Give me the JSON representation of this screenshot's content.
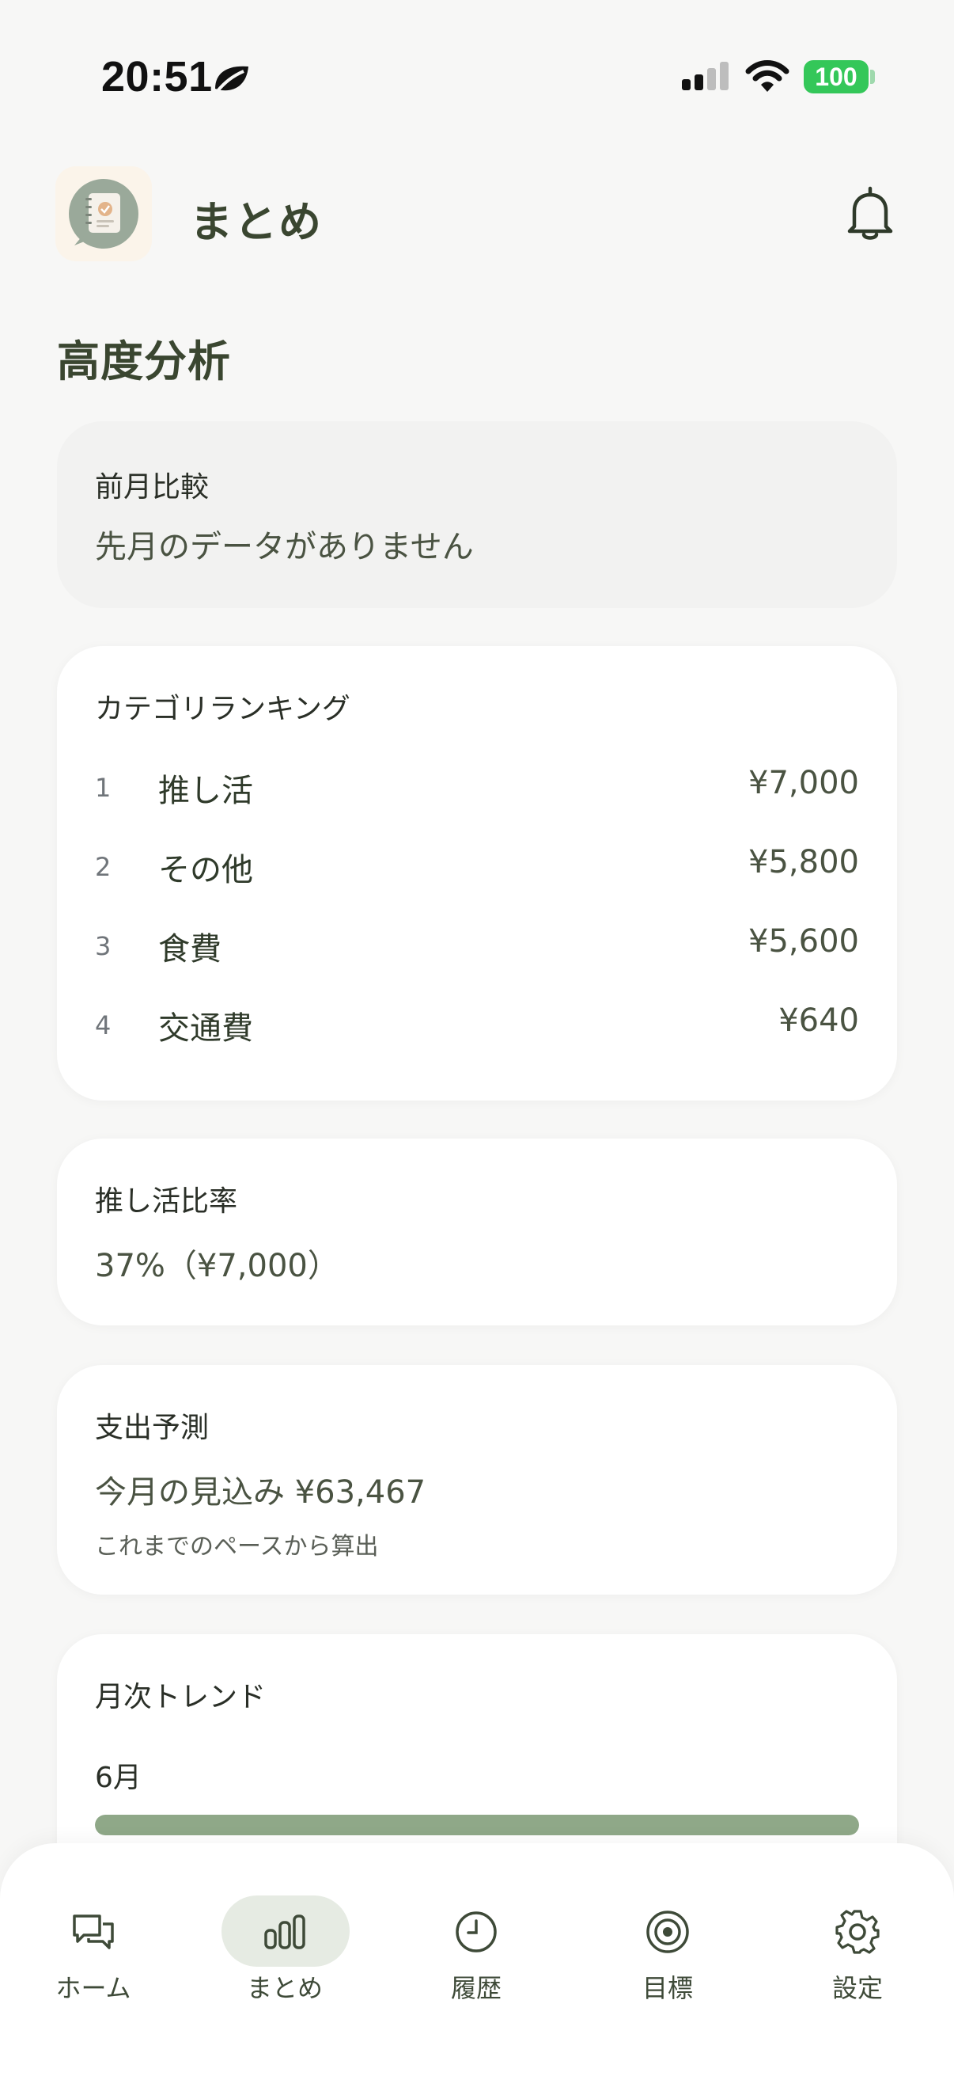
{
  "status_bar": {
    "time": "20:51",
    "battery": "100"
  },
  "header": {
    "title": "まとめ"
  },
  "section_title": "高度分析",
  "month_compare": {
    "title": "前月比較",
    "message": "先月のデータがありません"
  },
  "category_ranking": {
    "title": "カテゴリランキング",
    "items": [
      {
        "rank": "1",
        "name": "推し活",
        "amount": "¥7,000"
      },
      {
        "rank": "2",
        "name": "その他",
        "amount": "¥5,800"
      },
      {
        "rank": "3",
        "name": "食費",
        "amount": "¥5,600"
      },
      {
        "rank": "4",
        "name": "交通費",
        "amount": "¥640"
      }
    ]
  },
  "oshi_ratio": {
    "title": "推し活比率",
    "value": "37%（¥7,000）"
  },
  "forecast": {
    "title": "支出予測",
    "value": "今月の見込み ¥63,467",
    "note": "これまでのペースから算出"
  },
  "monthly_trend": {
    "title": "月次トレンド",
    "month": "6月",
    "fill_fraction": 1.0
  },
  "nav": {
    "items": [
      {
        "label": "ホーム",
        "icon": "chat-icon"
      },
      {
        "label": "まとめ",
        "icon": "bar-chart-icon",
        "active": true
      },
      {
        "label": "履歴",
        "icon": "clock-icon"
      },
      {
        "label": "目標",
        "icon": "target-icon"
      },
      {
        "label": "設定",
        "icon": "gear-icon"
      }
    ]
  },
  "colors": {
    "accent": "#8fa888",
    "battery": "#34c759",
    "nav_active_bg": "#e6ebe3"
  }
}
